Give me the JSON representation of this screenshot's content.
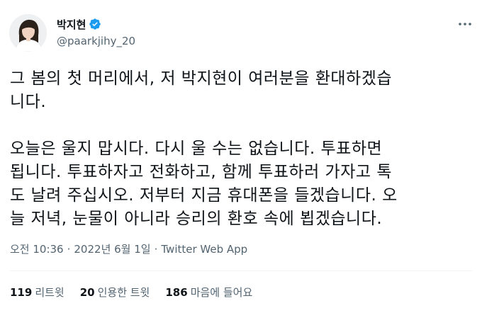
{
  "author": {
    "display_name": "박지현",
    "handle": "@paarkjihy_20",
    "verified_color": "#1d9bf0",
    "avatar_icon": "profile-photo"
  },
  "menu": {
    "icon": "more-dots-icon"
  },
  "tweet": {
    "text": "그 봄의 첫 머리에서, 저 박지현이 여러분을 환대하겠습\n니다.\n\n오늘은 울지 맙시다. 다시 울 수는 없습니다. 투표하면\n됩니다. 투표하자고 전화하고, 함께 투표하러 가자고 톡\n도 날려 주십시오. 저부터 지금 휴대폰을 들겠습니다. 오\n늘 저녁, 눈물이 아니라 승리의 환호 속에 뵙겠습니다."
  },
  "meta": {
    "time": "오전 10:36",
    "date": "2022년 6월 1일",
    "separator": "·",
    "source": "Twitter Web App"
  },
  "stats": {
    "retweets_count": "119",
    "retweets_label": "리트윗",
    "quotes_count": "20",
    "quotes_label": "인용한 트윗",
    "likes_count": "186",
    "likes_label": "마음에 들어요"
  }
}
